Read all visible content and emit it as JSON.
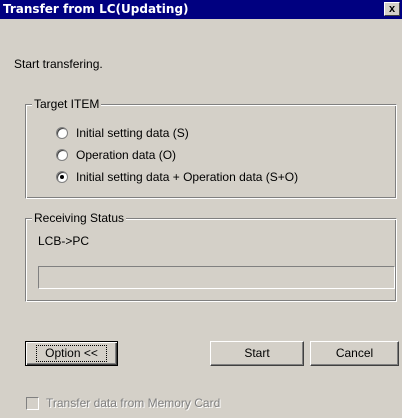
{
  "window": {
    "title": "Transfer from LC(Updating)",
    "close_glyph": "x"
  },
  "message": "Start transfering.",
  "target_item": {
    "legend": "Target ITEM",
    "options": [
      {
        "label": "Initial setting data (S)",
        "selected": false
      },
      {
        "label": "Operation data (O)",
        "selected": false
      },
      {
        "label": "Initial setting data + Operation data (S+O)",
        "selected": true
      }
    ]
  },
  "receiving_status": {
    "legend": "Receiving Status",
    "text": "LCB->PC",
    "progress": 0
  },
  "buttons": {
    "option": "Option <<",
    "start": "Start",
    "cancel": "Cancel"
  },
  "memory_card": {
    "label": "Transfer data from Memory Card",
    "checked": false,
    "enabled": false
  }
}
